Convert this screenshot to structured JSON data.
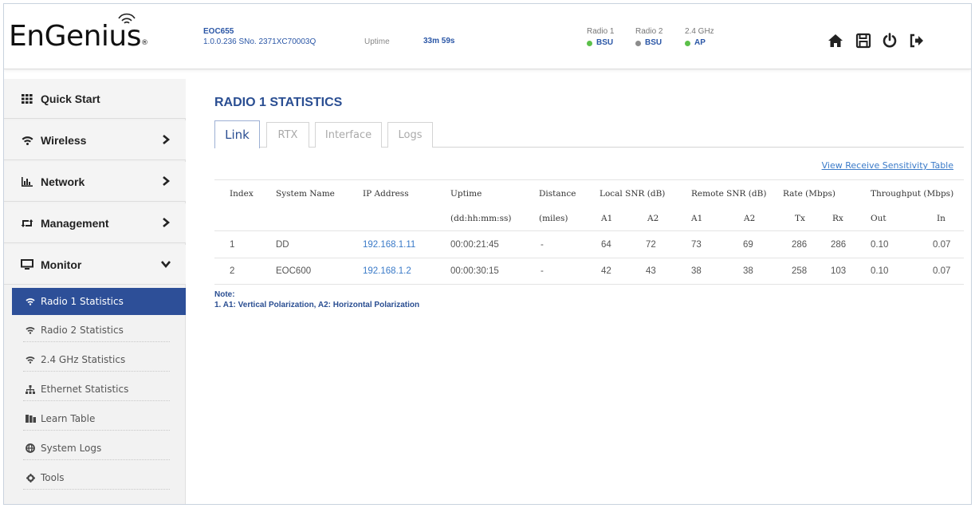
{
  "brand": {
    "name": "EnGenius",
    "reg": "®"
  },
  "device": {
    "model": "EOC655",
    "firmware": "1.0.0.236 SNo. 2371XC70003Q",
    "uptime_label": "Uptime",
    "uptime_value": "33m 59s"
  },
  "radios": [
    {
      "label": "Radio 1",
      "status": "BSU",
      "color": "#5cc04a"
    },
    {
      "label": "Radio 2",
      "status": "BSU",
      "color": "#8c8c8c"
    },
    {
      "label": "2.4 GHz",
      "status": "AP",
      "color": "#5cc04a"
    }
  ],
  "header_icons": [
    "home-icon",
    "save-icon",
    "power-icon",
    "logout-icon"
  ],
  "sidebar": {
    "menu": [
      {
        "label": "Quick Start",
        "icon": "grid-icon"
      },
      {
        "label": "Wireless",
        "icon": "wifi-icon"
      },
      {
        "label": "Network",
        "icon": "bar-chart-icon"
      },
      {
        "label": "Management",
        "icon": "retweet-icon"
      },
      {
        "label": "Monitor",
        "icon": "monitor-icon"
      }
    ],
    "submenu": [
      {
        "label": "Radio 1 Statistics",
        "icon": "wifi-icon"
      },
      {
        "label": "Radio 2 Statistics",
        "icon": "wifi-icon"
      },
      {
        "label": "2.4 GHz Statistics",
        "icon": "wifi-icon"
      },
      {
        "label": "Ethernet Statistics",
        "icon": "sitemap-icon"
      },
      {
        "label": "Learn Table",
        "icon": "table-icon"
      },
      {
        "label": "System Logs",
        "icon": "globe-icon"
      },
      {
        "label": "Tools",
        "icon": "gear-icon"
      }
    ]
  },
  "page": {
    "title": "RADIO 1 STATISTICS",
    "tabs": [
      "Link",
      "RTX",
      "Interface",
      "Logs"
    ],
    "link": "View Receive Sensitivity Table"
  },
  "table": {
    "header1": [
      "Index",
      "System Name",
      "IP Address",
      "Uptime",
      "Distance",
      "Local SNR (dB)",
      "Remote SNR (dB)",
      "Rate (Mbps)",
      "Throughput (Mbps)"
    ],
    "header2": [
      "(dd:hh:mm:ss)",
      "(miles)",
      "A1",
      "A2",
      "A1",
      "A2",
      "Tx",
      "Rx",
      "Out",
      "In"
    ],
    "rows": [
      [
        "1",
        "DD",
        "192.168.1.11",
        "00:00:21:45",
        "-",
        "64",
        "72",
        "73",
        "69",
        "286",
        "286",
        "0.10",
        "0.07"
      ],
      [
        "2",
        "EOC600",
        "192.168.1.2",
        "00:00:30:15",
        "-",
        "42",
        "43",
        "38",
        "38",
        "258",
        "103",
        "0.10",
        "0.07"
      ]
    ]
  },
  "note": {
    "title": "Note:",
    "line1": "1. A1: Vertical Polarization, A2: Horizontal Polarization"
  },
  "colors": {
    "accent": "#2a4e92",
    "active_bg": "#2d4f98",
    "link": "#3a7ac8"
  }
}
